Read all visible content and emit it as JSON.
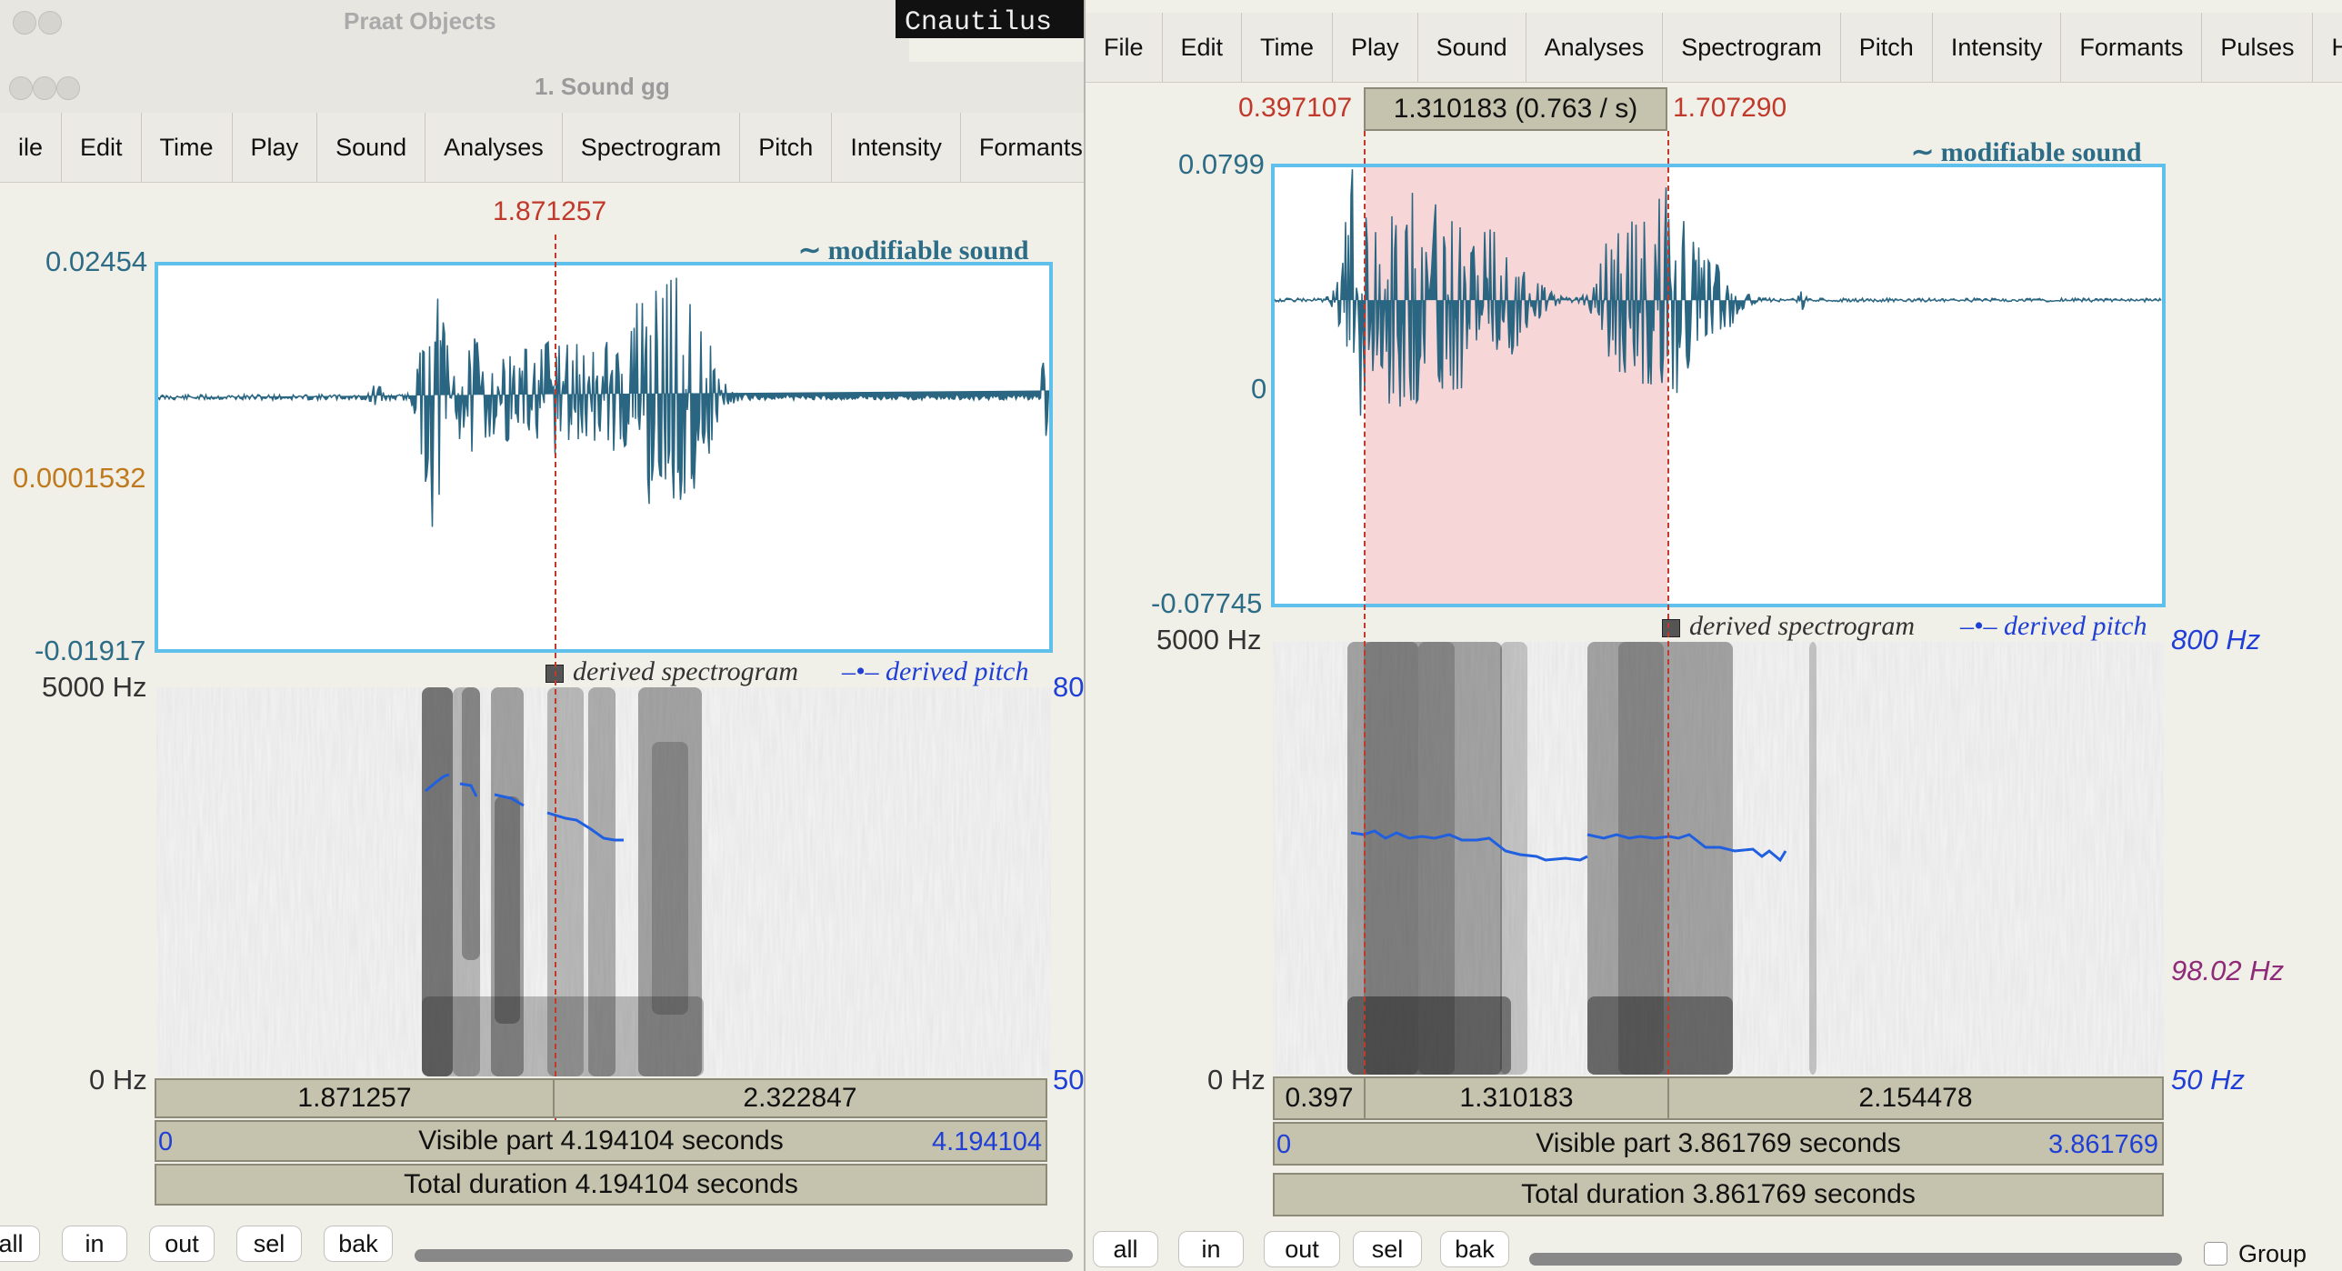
{
  "objects_window": {
    "title": "Praat Objects"
  },
  "terminal_snippet": {
    "text": "Cnautilus"
  },
  "left": {
    "title": "1. Sound gg",
    "menu": [
      "ile",
      "Edit",
      "Time",
      "Play",
      "Sound",
      "Analyses",
      "Spectrogram",
      "Pitch",
      "Intensity",
      "Formants"
    ],
    "cursor_time": "1.871257",
    "modifiable_label": "modifiable sound",
    "amp_top": "0.02454",
    "amp_mid": "0.0001532",
    "amp_bottom": "-0.01917",
    "freq_top": "5000 Hz",
    "freq_bottom": "0 Hz",
    "right_top_clip": "80",
    "right_bottom_clip": "50",
    "derived_spectrogram": "derived spectrogram",
    "derived_pitch": "derived pitch",
    "seg_left": "1.871257",
    "seg_right": "2.322847",
    "visible_start": "0",
    "visible_text": "Visible part 4.194104 seconds",
    "visible_end": "4.194104",
    "total_text": "Total duration 4.194104 seconds",
    "buttons": [
      "all",
      "in",
      "out",
      "sel",
      "bak"
    ]
  },
  "right": {
    "menu": [
      "File",
      "Edit",
      "Time",
      "Play",
      "Sound",
      "Analyses",
      "Spectrogram",
      "Pitch",
      "Intensity",
      "Formants",
      "Pulses",
      "Help"
    ],
    "sel_start": "0.397107",
    "sel_duration": "1.310183 (0.763  / s)",
    "sel_end": "1.707290",
    "modifiable_label": "modifiable sound",
    "amp_top": "0.0799",
    "amp_mid": "0",
    "amp_bottom": "-0.07745",
    "freq_top": "5000 Hz",
    "freq_bottom": "0 Hz",
    "pitch_top": "800 Hz",
    "pitch_value": "98.02 Hz",
    "pitch_bottom": "50 Hz",
    "derived_spectrogram": "derived spectrogram",
    "derived_pitch": "derived pitch",
    "seg_a": "0.397",
    "seg_b": "1.310183",
    "seg_c": "2.154478",
    "visible_start": "0",
    "visible_text": "Visible part 3.861769 seconds",
    "visible_end": "3.861769",
    "total_text": "Total duration 3.861769 seconds",
    "buttons": [
      "all",
      "in",
      "out",
      "sel",
      "bak"
    ],
    "group_label": "Group"
  },
  "colors": {
    "waveform": "#2a6682",
    "selection": "#f6d6d6",
    "cursor": "#c0392b",
    "pitch_line": "#1f5fe0",
    "frame": "#5fc0ec",
    "info_bar": "#c5c3ad"
  }
}
